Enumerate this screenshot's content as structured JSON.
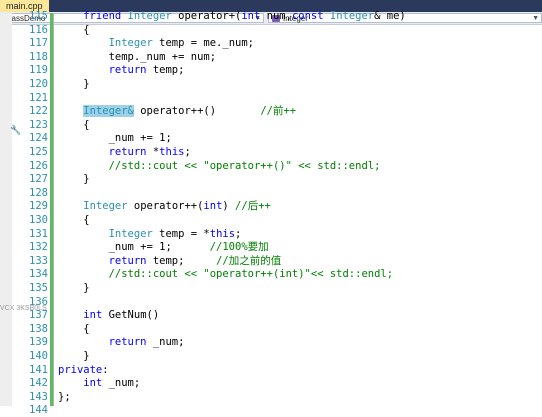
{
  "tab": {
    "label": "main.cpp"
  },
  "nav": {
    "scope": "ClassDemo",
    "member": "Integer"
  },
  "gutter": {
    "marker_icon": "wrench-icon",
    "overlay_text": "VCX 3KSB0LS"
  },
  "lines": [
    {
      "n": "115",
      "segs": [
        {
          "t": "    friend ",
          "c": "kw"
        },
        {
          "t": "Integer",
          "c": "ty"
        },
        {
          "t": " operator+(",
          "c": ""
        },
        {
          "t": "int",
          "c": "kw"
        },
        {
          "t": " num,",
          "c": ""
        },
        {
          "t": "const",
          "c": "kw"
        },
        {
          "t": " ",
          "c": ""
        },
        {
          "t": "Integer",
          "c": "ty"
        },
        {
          "t": "& me)",
          "c": ""
        }
      ]
    },
    {
      "n": "116",
      "segs": [
        {
          "t": "    {",
          "c": ""
        }
      ]
    },
    {
      "n": "117",
      "segs": [
        {
          "t": "        ",
          "c": ""
        },
        {
          "t": "Integer",
          "c": "ty"
        },
        {
          "t": " temp = me._num;",
          "c": ""
        }
      ]
    },
    {
      "n": "118",
      "segs": [
        {
          "t": "        temp._num += num;",
          "c": ""
        }
      ]
    },
    {
      "n": "119",
      "segs": [
        {
          "t": "        ",
          "c": ""
        },
        {
          "t": "return",
          "c": "kw"
        },
        {
          "t": " temp;",
          "c": ""
        }
      ]
    },
    {
      "n": "120",
      "segs": [
        {
          "t": "    }",
          "c": ""
        }
      ]
    },
    {
      "n": "121",
      "segs": [
        {
          "t": "",
          "c": ""
        }
      ]
    },
    {
      "n": "122",
      "segs": [
        {
          "t": "    ",
          "c": ""
        },
        {
          "t": "Integer&",
          "c": "ty hl"
        },
        {
          "t": " operator++()       ",
          "c": ""
        },
        {
          "t": "//前++",
          "c": "cm"
        }
      ]
    },
    {
      "n": "123",
      "segs": [
        {
          "t": "    {",
          "c": ""
        }
      ]
    },
    {
      "n": "124",
      "segs": [
        {
          "t": "        _num += 1;",
          "c": ""
        }
      ]
    },
    {
      "n": "125",
      "segs": [
        {
          "t": "        ",
          "c": ""
        },
        {
          "t": "return",
          "c": "kw"
        },
        {
          "t": " *",
          "c": ""
        },
        {
          "t": "this",
          "c": "kw"
        },
        {
          "t": ";",
          "c": ""
        }
      ]
    },
    {
      "n": "126",
      "segs": [
        {
          "t": "        ",
          "c": ""
        },
        {
          "t": "//std::cout << \"operator++()\" << std::endl;",
          "c": "cm"
        }
      ]
    },
    {
      "n": "127",
      "segs": [
        {
          "t": "    }",
          "c": ""
        }
      ]
    },
    {
      "n": "128",
      "segs": [
        {
          "t": "",
          "c": ""
        }
      ]
    },
    {
      "n": "129",
      "segs": [
        {
          "t": "    ",
          "c": ""
        },
        {
          "t": "Integer",
          "c": "ty"
        },
        {
          "t": " operator++(",
          "c": ""
        },
        {
          "t": "int",
          "c": "kw"
        },
        {
          "t": ") ",
          "c": ""
        },
        {
          "t": "//后++",
          "c": "cm"
        }
      ]
    },
    {
      "n": "130",
      "segs": [
        {
          "t": "    {",
          "c": ""
        }
      ]
    },
    {
      "n": "131",
      "segs": [
        {
          "t": "        ",
          "c": ""
        },
        {
          "t": "Integer",
          "c": "ty"
        },
        {
          "t": " temp = *",
          "c": ""
        },
        {
          "t": "this",
          "c": "kw"
        },
        {
          "t": ";",
          "c": ""
        }
      ]
    },
    {
      "n": "132",
      "segs": [
        {
          "t": "        _num += 1;      ",
          "c": ""
        },
        {
          "t": "//100%要加",
          "c": "cm"
        }
      ]
    },
    {
      "n": "133",
      "segs": [
        {
          "t": "        ",
          "c": ""
        },
        {
          "t": "return",
          "c": "kw"
        },
        {
          "t": " temp;     ",
          "c": ""
        },
        {
          "t": "//加之前的值",
          "c": "cm"
        }
      ]
    },
    {
      "n": "134",
      "segs": [
        {
          "t": "        ",
          "c": ""
        },
        {
          "t": "//std::cout << \"operator++(int)\"<< std::endl;",
          "c": "cm"
        }
      ]
    },
    {
      "n": "135",
      "segs": [
        {
          "t": "    }",
          "c": ""
        }
      ]
    },
    {
      "n": "136",
      "segs": [
        {
          "t": "",
          "c": ""
        }
      ]
    },
    {
      "n": "137",
      "segs": [
        {
          "t": "    ",
          "c": ""
        },
        {
          "t": "int",
          "c": "kw"
        },
        {
          "t": " GetNum()",
          "c": ""
        }
      ]
    },
    {
      "n": "138",
      "segs": [
        {
          "t": "    {",
          "c": ""
        }
      ]
    },
    {
      "n": "139",
      "segs": [
        {
          "t": "        ",
          "c": ""
        },
        {
          "t": "return",
          "c": "kw"
        },
        {
          "t": " _num;",
          "c": ""
        }
      ]
    },
    {
      "n": "140",
      "segs": [
        {
          "t": "    }",
          "c": ""
        }
      ]
    },
    {
      "n": "141",
      "segs": [
        {
          "t": "private",
          "c": "kw"
        },
        {
          "t": ":",
          "c": ""
        }
      ]
    },
    {
      "n": "142",
      "segs": [
        {
          "t": "    ",
          "c": ""
        },
        {
          "t": "int",
          "c": "kw"
        },
        {
          "t": " _num;",
          "c": ""
        }
      ]
    },
    {
      "n": "143",
      "segs": [
        {
          "t": "};",
          "c": ""
        }
      ]
    },
    {
      "n": "144",
      "segs": [
        {
          "t": "",
          "c": ""
        }
      ]
    }
  ]
}
